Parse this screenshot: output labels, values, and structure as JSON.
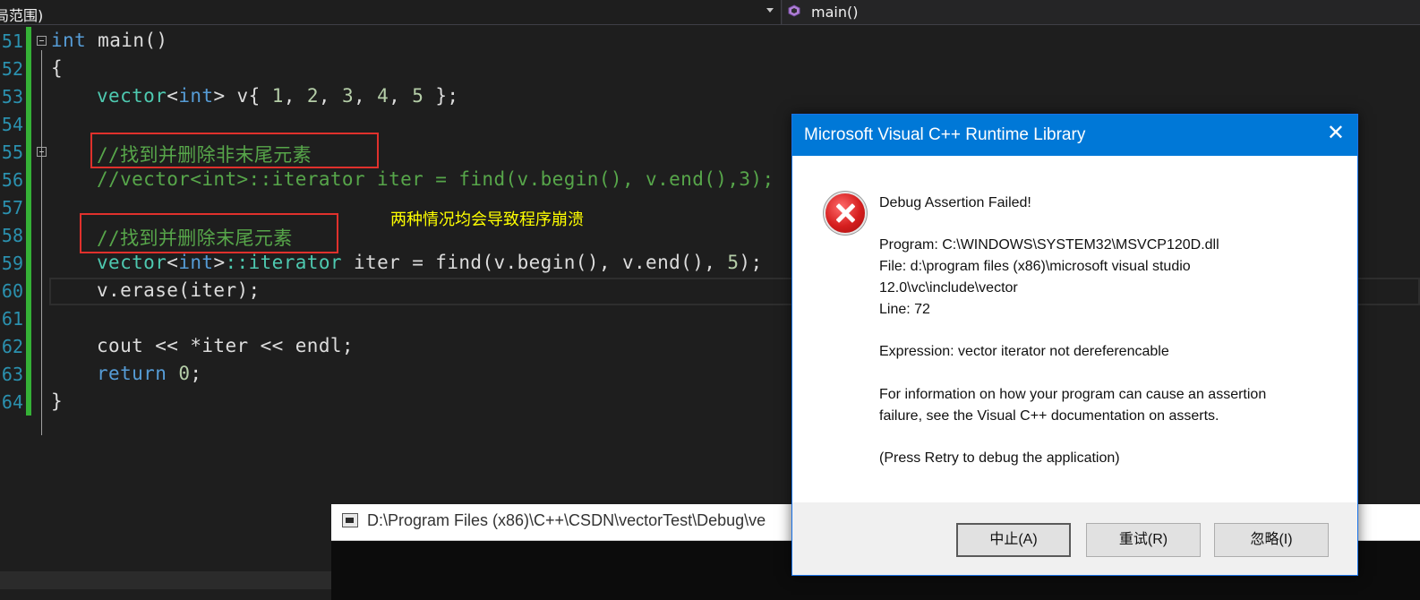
{
  "navbar": {
    "scope_label": "局范围)",
    "function_label": "main()"
  },
  "lines": [
    {
      "num": "51"
    },
    {
      "num": "52"
    },
    {
      "num": "53"
    },
    {
      "num": "54"
    },
    {
      "num": "55"
    },
    {
      "num": "56"
    },
    {
      "num": "57"
    },
    {
      "num": "58"
    },
    {
      "num": "59"
    },
    {
      "num": "60"
    },
    {
      "num": "61"
    },
    {
      "num": "62"
    },
    {
      "num": "63"
    },
    {
      "num": "64"
    }
  ],
  "code": {
    "l51_kw": "int",
    "l51_rest": " main()",
    "l52": "{",
    "l53_type": "vector",
    "l53_lt": "<",
    "l53_int": "int",
    "l53_gt": ">",
    "l53_pre": " v{ ",
    "l53_n1": "1",
    "l53_c1": ", ",
    "l53_n2": "2",
    "l53_c2": ", ",
    "l53_n3": "3",
    "l53_c3": ", ",
    "l53_n4": "4",
    "l53_c4": ", ",
    "l53_n5": "5",
    "l53_end": " };",
    "l55": "//找到并删除非末尾元素",
    "l56": "//vector<int>::iterator iter = find(v.begin(), v.end(),3);",
    "l58": "//找到并删除末尾元素",
    "l59_type": "vector",
    "l59_lt": "<",
    "l59_int": "int",
    "l59_gt": ">",
    "l59_iter": "::iterator",
    "l59_rest": " iter = find(v.begin(), v.end(), ",
    "l59_n": "5",
    "l59_end": ");",
    "l60": "v.erase(iter);",
    "l62": "cout << *iter << endl;",
    "l63_kw": "return",
    "l63_sp": " ",
    "l63_n": "0",
    "l63_end": ";",
    "l64": "}"
  },
  "annotation": "两种情况均会导致程序崩溃",
  "console": {
    "title": "D:\\Program Files (x86)\\C++\\CSDN\\vectorTest\\Debug\\ve"
  },
  "dialog": {
    "title": "Microsoft Visual C++ Runtime Library",
    "close_glyph": "✕",
    "heading": "Debug Assertion Failed!",
    "program": "Program: C:\\WINDOWS\\SYSTEM32\\MSVCP120D.dll",
    "file_line1": "File: d:\\program files (x86)\\microsoft visual studio",
    "file_line2": "12.0\\vc\\include\\vector",
    "line": "Line: 72",
    "expression": "Expression: vector iterator not dereferencable",
    "info_line1": "For information on how your program can cause an assertion",
    "info_line2": "failure, see the Visual C++ documentation on asserts.",
    "retry_hint": "(Press Retry to debug the application)",
    "buttons": {
      "abort": "中止(A)",
      "retry": "重试(R)",
      "ignore": "忽略(I)"
    }
  },
  "colors": {
    "editor_bg": "#1e1e1e",
    "keyword": "#569cd6",
    "type": "#4ec9b0",
    "comment": "#57a64a",
    "number": "#b5cea8",
    "line_number": "#2b91af",
    "change_bar": "#35b136",
    "highlight_box": "#e0312c",
    "annotation": "#ffff00",
    "dialog_title": "#0078d7"
  }
}
